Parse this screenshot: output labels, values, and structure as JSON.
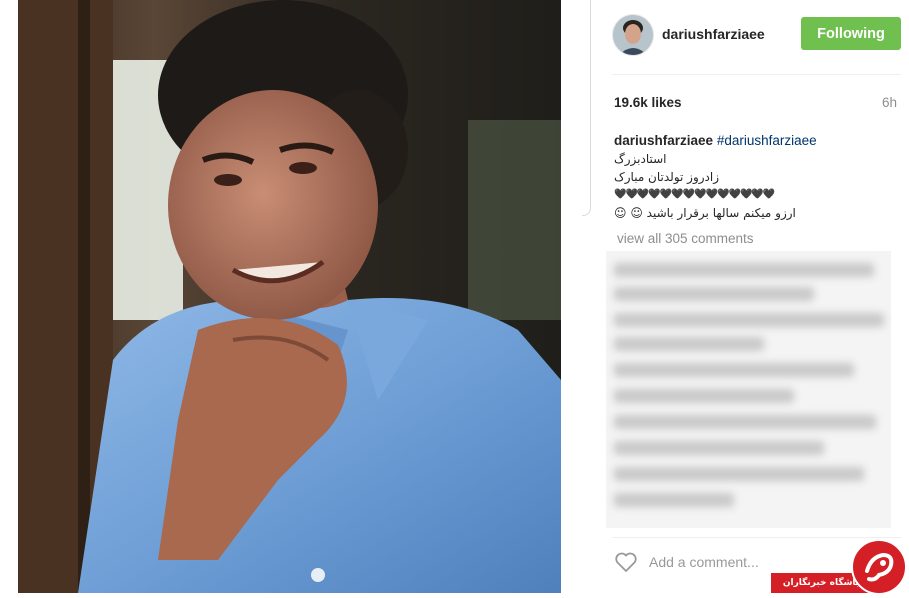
{
  "post": {
    "username": "dariushfarziaee",
    "follow_button_label": "Following",
    "likes": "19.6k likes",
    "time_ago": "6h"
  },
  "caption": {
    "username": "dariushfarziaee",
    "hashtag": "#dariushfarziaee",
    "lines": [
      "استادبزرگ",
      "زادروز تولدتان مبارک",
      "🖤🖤🖤🖤🖤🖤🖤🖤🖤🖤🖤🖤🖤🖤",
      "ارزو میکنم سالها برقرار باشید ☺ ☺"
    ]
  },
  "comments": {
    "view_all_label": "view all 305 comments",
    "add_comment_placeholder": "Add a comment..."
  },
  "watermark": {
    "text": "باشگاه خبرنگاران",
    "color": "#d51f26"
  },
  "colors": {
    "follow_button": "#70c050",
    "hashtag": "#003569",
    "muted_text": "#8e8e8e"
  },
  "icons": {
    "like": "heart-outline-icon",
    "watermark_logo": "news-club-logo-icon"
  }
}
